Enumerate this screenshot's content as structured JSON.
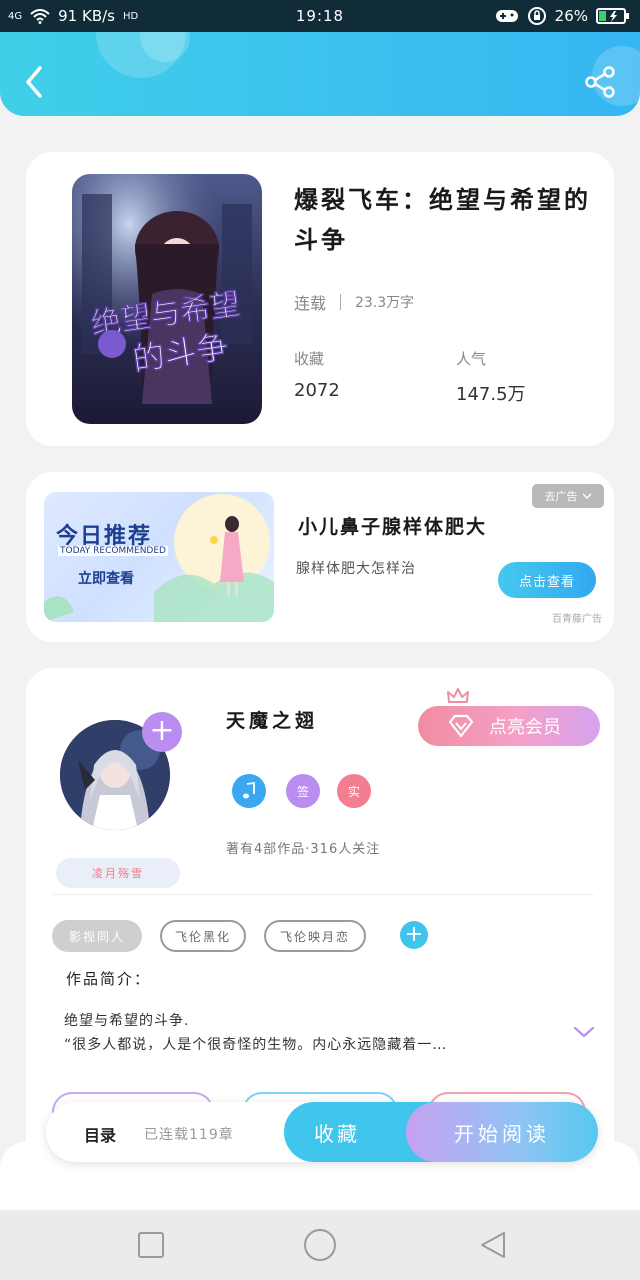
{
  "status_bar": {
    "network": "4G",
    "speed": "91 KB/s",
    "hd": "HD",
    "time": "19:18",
    "battery": "26%"
  },
  "header": {
    "back_icon": "chevron-left-icon",
    "share_icon": "share-icon"
  },
  "book": {
    "title": "爆裂飞车：绝望与希望的斗争",
    "status": "连载",
    "word_count": "23.3万字",
    "favorites_label": "收藏",
    "favorites_value": "2072",
    "popularity_label": "人气",
    "popularity_value": "147.5万"
  },
  "ad": {
    "image_title": "今日推荐",
    "image_subtitle": "TODAY RECOMMENDED",
    "image_cta": "立即查看",
    "title": "小儿鼻子腺样体肥大",
    "description": "腺样体肥大怎样治",
    "close_label": "去广告",
    "button": "点击查看",
    "source": "百青藤广告"
  },
  "author": {
    "name": "天魔之翅",
    "tag": "凌月殇雪",
    "vip_button": "点亮会员",
    "badges": [
      {
        "label": "",
        "icon": "music-note-icon",
        "color": "#3aa7f0"
      },
      {
        "label": "签",
        "color": "#b98ef0"
      },
      {
        "label": "实",
        "color": "#f27e8f"
      }
    ],
    "stats": "著有4部作品·316人关注"
  },
  "tags": [
    "影视同人",
    "飞伦黑化",
    "飞伦映月恋"
  ],
  "intro": {
    "label": "作品简介：",
    "line1": "绝望与希望的斗争.",
    "line2": "“很多人都说，人是个很奇怪的生物。内心永远隐藏着一…"
  },
  "bottom_bar": {
    "toc_label": "目录",
    "toc_status": "已连载119章",
    "collect": "收藏",
    "read": "开始阅读"
  },
  "colors": {
    "accent": "#3fc4ec",
    "vip_pink": "#f08da0",
    "purple": "#b98ef0"
  }
}
